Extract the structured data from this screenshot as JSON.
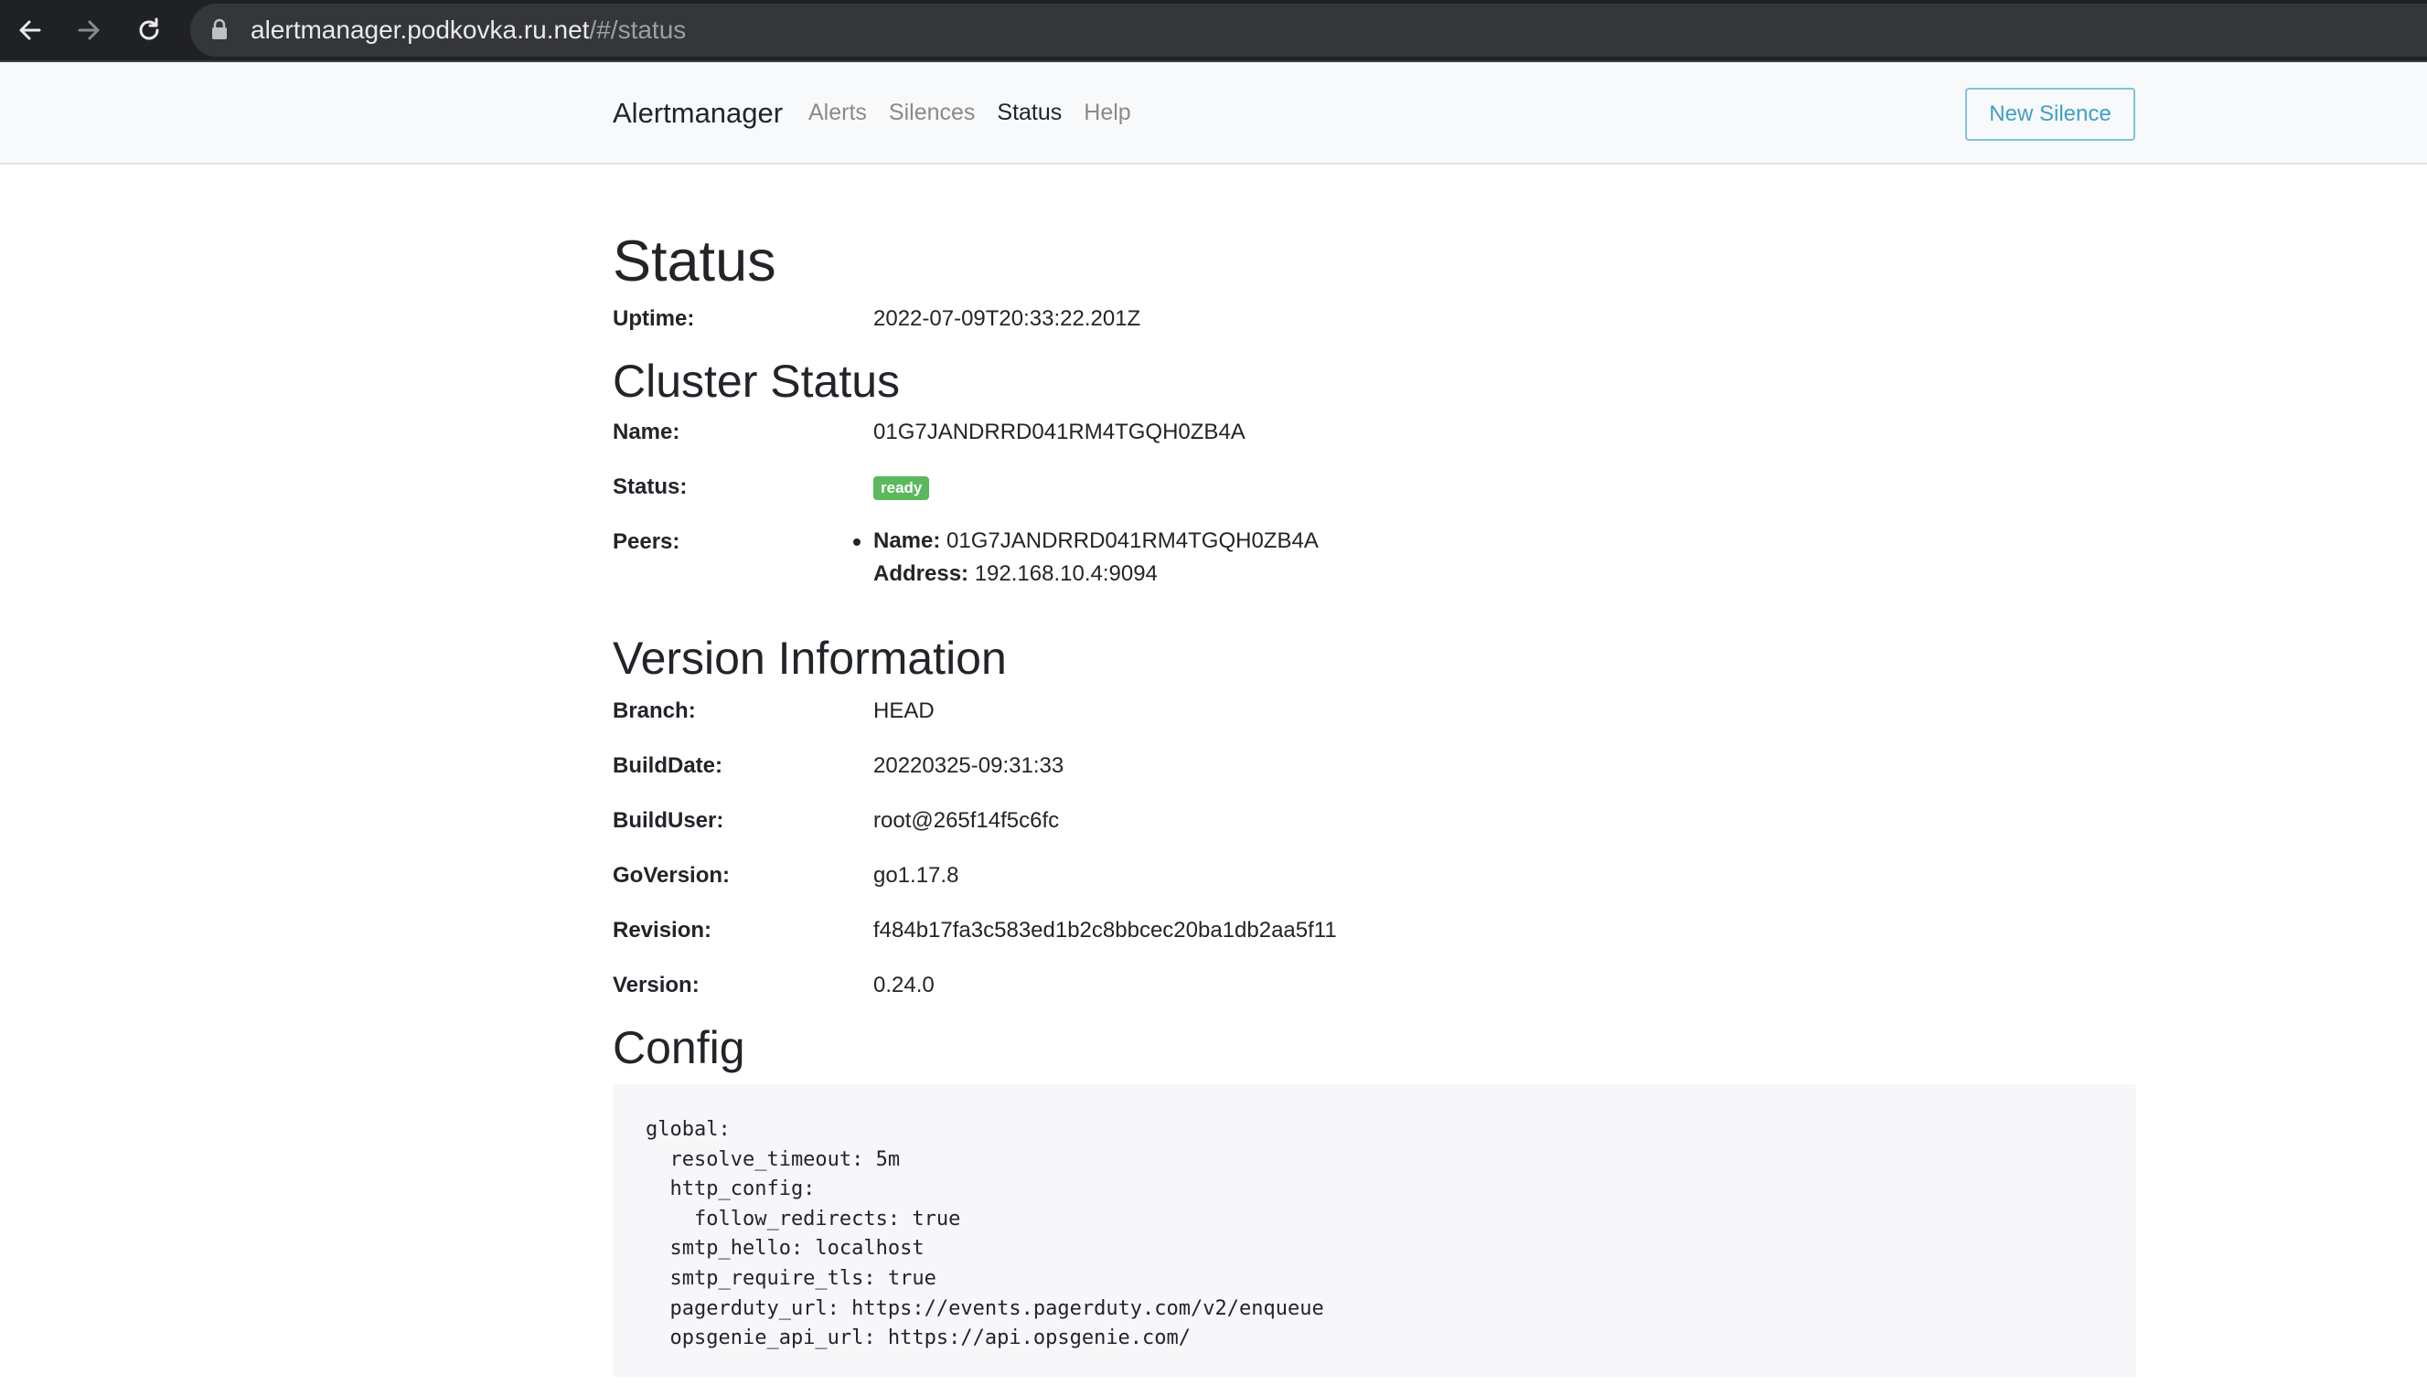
{
  "browser": {
    "url_host": "alertmanager.podkovka.ru.net",
    "url_path": "/#/status"
  },
  "navbar": {
    "brand": "Alertmanager",
    "links": [
      "Alerts",
      "Silences",
      "Status",
      "Help"
    ],
    "active_link": "Status",
    "new_silence_label": "New Silence"
  },
  "status": {
    "title": "Status",
    "uptime_label": "Uptime:",
    "uptime_value": "2022-07-09T20:33:22.201Z"
  },
  "cluster": {
    "title": "Cluster Status",
    "name_label": "Name:",
    "name_value": "01G7JANDRRD041RM4TGQH0ZB4A",
    "status_label": "Status:",
    "status_badge": "ready",
    "peers_label": "Peers:",
    "peers": [
      {
        "name_label": "Name:",
        "name": "01G7JANDRRD041RM4TGQH0ZB4A",
        "address_label": "Address:",
        "address": "192.168.10.4:9094"
      }
    ]
  },
  "version": {
    "title": "Version Information",
    "rows": [
      {
        "label": "Branch:",
        "value": "HEAD"
      },
      {
        "label": "BuildDate:",
        "value": "20220325-09:31:33"
      },
      {
        "label": "BuildUser:",
        "value": "root@265f14f5c6fc"
      },
      {
        "label": "GoVersion:",
        "value": "go1.17.8"
      },
      {
        "label": "Revision:",
        "value": "f484b17fa3c583ed1b2c8bbcec20ba1db2aa5f11"
      },
      {
        "label": "Version:",
        "value": "0.24.0"
      }
    ]
  },
  "config": {
    "title": "Config",
    "text": "global:\n  resolve_timeout: 5m\n  http_config:\n    follow_redirects: true\n  smtp_hello: localhost\n  smtp_require_tls: true\n  pagerduty_url: https://events.pagerduty.com/v2/enqueue\n  opsgenie_api_url: https://api.opsgenie.com/"
  },
  "colors": {
    "badge_success": "#5cb85c",
    "new_silence_border": "#7fc3db",
    "new_silence_text": "#3f9fc8",
    "navbar_bg": "#f8f9fa",
    "config_bg": "#f7f7f9"
  }
}
